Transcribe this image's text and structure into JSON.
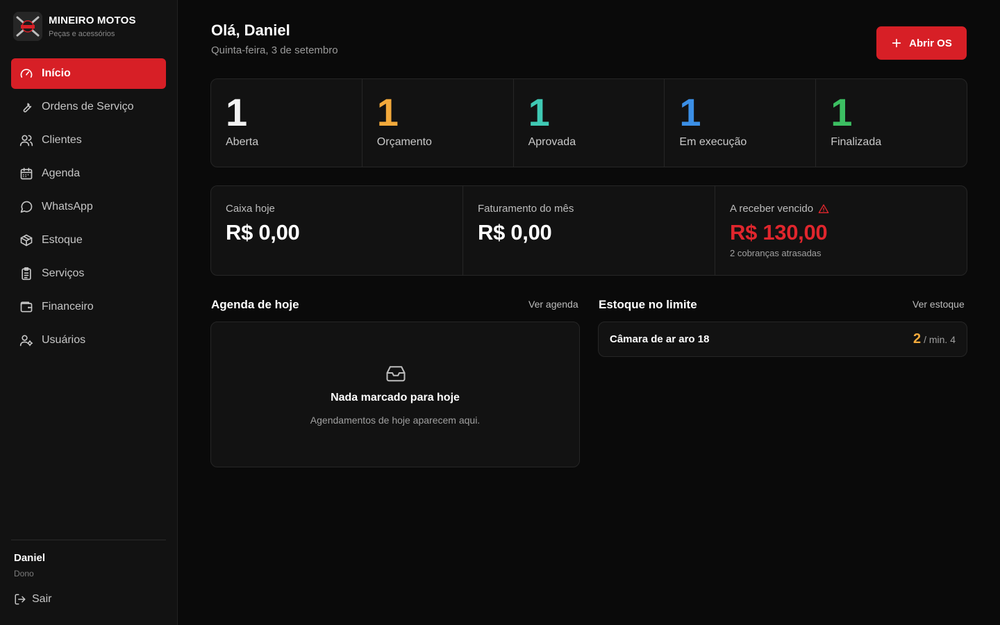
{
  "brand": {
    "name": "MINEIRO MOTOS",
    "subtitle": "Peças e acessórios",
    "logo_text": "MINEIRO"
  },
  "sidebar": {
    "items": [
      {
        "label": "Início",
        "icon": "gauge-icon",
        "active": true
      },
      {
        "label": "Ordens de Serviço",
        "icon": "wrench-icon"
      },
      {
        "label": "Clientes",
        "icon": "users-icon"
      },
      {
        "label": "Agenda",
        "icon": "calendar-icon"
      },
      {
        "label": "WhatsApp",
        "icon": "chat-icon"
      },
      {
        "label": "Estoque",
        "icon": "box-icon"
      },
      {
        "label": "Serviços",
        "icon": "clipboard-icon"
      },
      {
        "label": "Financeiro",
        "icon": "wallet-icon"
      },
      {
        "label": "Usuários",
        "icon": "user-cog-icon"
      }
    ],
    "user": {
      "name": "Daniel",
      "role": "Dono"
    },
    "logout_label": "Sair"
  },
  "header": {
    "greeting": "Olá, Daniel",
    "date": "Quinta-feira, 3 de setembro",
    "new_os_label": "Abrir OS"
  },
  "status": [
    {
      "count": "1",
      "label": "Aberta",
      "color": "#f2f2f2"
    },
    {
      "count": "1",
      "label": "Orçamento",
      "color": "#f2a93b"
    },
    {
      "count": "1",
      "label": "Aprovada",
      "color": "#3fc9b4"
    },
    {
      "count": "1",
      "label": "Em execução",
      "color": "#3b8fe6"
    },
    {
      "count": "1",
      "label": "Finalizada",
      "color": "#3cbf62"
    }
  ],
  "finance": {
    "cash_today": {
      "label": "Caixa hoje",
      "value": "R$ 0,00"
    },
    "month_revenue": {
      "label": "Faturamento do mês",
      "value": "R$ 0,00"
    },
    "overdue": {
      "label": "A receber vencido",
      "value": "R$ 130,00",
      "note": "2 cobranças atrasadas",
      "color": "#e0262d"
    }
  },
  "agenda": {
    "title": "Agenda de hoje",
    "link": "Ver agenda",
    "empty_title": "Nada marcado para hoje",
    "empty_sub": "Agendamentos de hoje aparecem aqui."
  },
  "stock": {
    "title": "Estoque no limite",
    "link": "Ver estoque",
    "items": [
      {
        "name": "Câmara de ar aro 18",
        "qty": "2",
        "min": "/ min. 4"
      }
    ]
  },
  "colors": {
    "accent": "#d71f26",
    "background": "#0a0a0a",
    "panel": "#121212"
  }
}
